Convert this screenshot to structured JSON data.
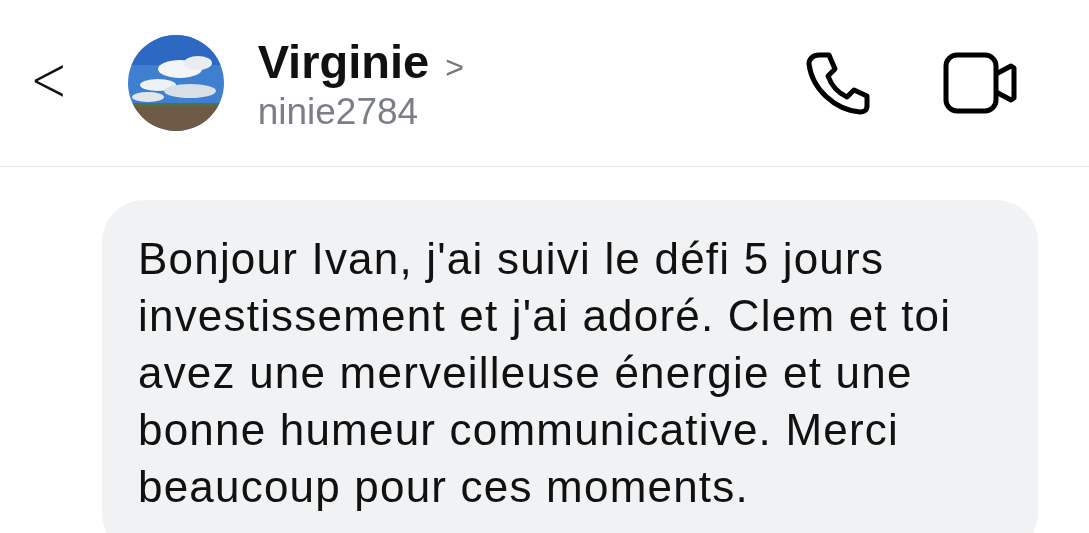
{
  "header": {
    "back": "<",
    "name": "Virginie",
    "name_chevron": ">",
    "username": "ninie2784"
  },
  "messages": [
    {
      "kind": "incoming",
      "text": "Bonjour Ivan, j'ai suivi le défi 5 jours\ninvestissement et j'ai adoré. Clem et toi\navez une merveilleuse énergie et une\nbonne humeur communicative. Merci\nbeaucoup pour ces moments."
    }
  ]
}
